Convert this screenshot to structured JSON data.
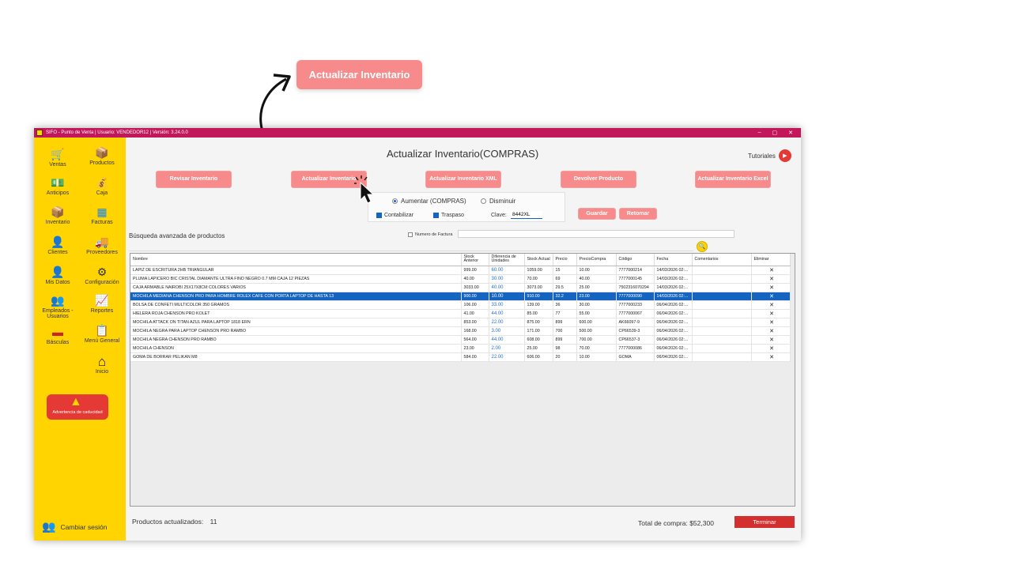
{
  "callout": {
    "label": "Actualizar Inventario"
  },
  "window": {
    "title": "SIFO - Punto de Venta      |  Usuario: VENDEDOR12 | Versión: 3.24.0.0",
    "controls": [
      "–",
      "▢",
      "✕"
    ]
  },
  "sidebar": {
    "items": [
      {
        "label": "Ventas",
        "icon": "cart-icon"
      },
      {
        "label": "Productos",
        "icon": "box-icon"
      },
      {
        "label": "Anticipos",
        "icon": "hand-money-icon"
      },
      {
        "label": "Caja",
        "icon": "cash-register-icon"
      },
      {
        "label": "Inventario",
        "icon": "boxes-icon"
      },
      {
        "label": "Facturas",
        "icon": "invoice-icon"
      },
      {
        "label": "Clientes",
        "icon": "client-icon"
      },
      {
        "label": "Proveedores",
        "icon": "truck-icon"
      },
      {
        "label": "Mis Datos",
        "icon": "user-icon"
      },
      {
        "label": "Configuración",
        "icon": "gear-icon"
      },
      {
        "label": "Empleados - Usuarios",
        "icon": "employees-icon"
      },
      {
        "label": "Reportes",
        "icon": "chart-icon"
      },
      {
        "label": "Básculas",
        "icon": "scale-icon"
      },
      {
        "label": "Menú General",
        "icon": "clipboard-icon"
      },
      {
        "label": "Inicio",
        "icon": "home-icon"
      }
    ],
    "warning_label": "Advertencia de caducidad",
    "logout_label": "Cambiar sesión"
  },
  "main": {
    "title": "Actualizar Inventario(COMPRAS)",
    "tutorials_label": "Tutoriales",
    "buttons": {
      "revisar": "Revisar Inventario",
      "actualizar": "Actualizar Inventario",
      "actualizar_xml": "Actualizar Inventario XML",
      "devolver": "Devolver Producto",
      "actualizar_excel": "Actualizar Inventario Excel",
      "guardar": "Guardar",
      "retomar": "Retomar",
      "terminar": "Terminar"
    },
    "options": {
      "aumentar": "Aumentar (COMPRAS)",
      "disminuir": "Disminuir",
      "contabilizar": "Contabilizar",
      "traspaso": "Traspaso",
      "clave_label": "Clave:",
      "clave_value": "8442XL"
    },
    "search": {
      "label": "Búsqueda avanzada de productos",
      "factura_label": "Numero de Factura"
    },
    "table": {
      "headers": [
        "Nombre",
        "Stock Anterior",
        "Diferencia de Unidades",
        "Stock Actual",
        "Precio",
        "PrecioCompra",
        "Código",
        "Fecha",
        "Comentarios",
        "Eliminar"
      ],
      "rows": [
        [
          "LAPIZ DE ESCRITURA 2HB TRIANGULAR",
          "999.00",
          "60.00",
          "1059.00",
          "15",
          "10.00",
          "7777000214",
          "14/03/2026 02:...",
          "",
          "✕"
        ],
        [
          "PLUMA LAPICERO BIC CRISTAL DIAMANTE ULTRA FINO NEGRO 0.7 MM CAJA 12 PIEZAS",
          "40.00",
          "30.00",
          "70.00",
          "69",
          "40.00",
          "7777000145",
          "14/03/2026 02:...",
          "",
          "✕"
        ],
        [
          "CAJA ARMABLE NAIROBI 25X17X8CM COLORES VARIOS",
          "3033.00",
          "40.00",
          "3073.00",
          "29.5",
          "25.00",
          "7502316070294",
          "14/03/2026 02:...",
          "",
          "✕"
        ],
        [
          "MOCHILA MEDIANA CHENSON PRO PARA HOMBRE ROLEX CAFE CON PORTA LAPTOP DE HASTA 13",
          "900.00",
          "10.00",
          "910.00",
          "32.2",
          "23.00",
          "7777000090",
          "14/03/2026 02:...",
          "",
          "✕"
        ],
        [
          "BOLSA DE CONFETI MULTICOLOR 350 GRAMOS",
          "106.00",
          "33.00",
          "139.00",
          "36",
          "30.00",
          "7777000233",
          "06/04/2026 02:...",
          "",
          "✕"
        ],
        [
          "HIELERA ROJA CHENSON PRO KOLET",
          "41.00",
          "44.00",
          "85.00",
          "77",
          "55.00",
          "7777000067",
          "06/04/2026 02:...",
          "",
          "✕"
        ],
        [
          "MOCHILA ATTACK ON TITAN AZUL PARA LAPTOP 1818 ERN",
          "853.00",
          "22.00",
          "875.00",
          "899",
          "600.00",
          "AK66097-9",
          "06/04/2026 02:...",
          "",
          "✕"
        ],
        [
          "MOCHILA NEGRA PARA LAPTOP CHENSON PRO RAMBO",
          "168.00",
          "3.00",
          "171.00",
          "700",
          "500.00",
          "CP66539-3",
          "06/04/2026 02:...",
          "",
          "✕"
        ],
        [
          "MOCHILA NEGRA CHENSON PRO RAMBO",
          "564.00",
          "44.00",
          "608.00",
          "899",
          "700.00",
          "CP66537-3",
          "06/04/2026 02:...",
          "",
          "✕"
        ],
        [
          "MOCHILA CHENSON",
          "23.00",
          "2.00",
          "25.00",
          "98",
          "70.00",
          "7777000086",
          "06/04/2026 02:...",
          "",
          "✕"
        ],
        [
          "GOMA DE BORRAR PELIKAN M8",
          "584.00",
          "22.00",
          "606.00",
          "20",
          "10.00",
          "GOMA",
          "06/04/2026 02:...",
          "",
          "✕"
        ]
      ]
    },
    "footer": {
      "count_label": "Productos actualizados:",
      "count_value": "11",
      "total_label": "Total de compra: $52,300"
    }
  },
  "colors": {
    "accent": "#c2185b",
    "sidebar": "#ffd400",
    "button": "#f78b8b",
    "selected": "#1565c0",
    "terminar": "#d32f2f"
  }
}
